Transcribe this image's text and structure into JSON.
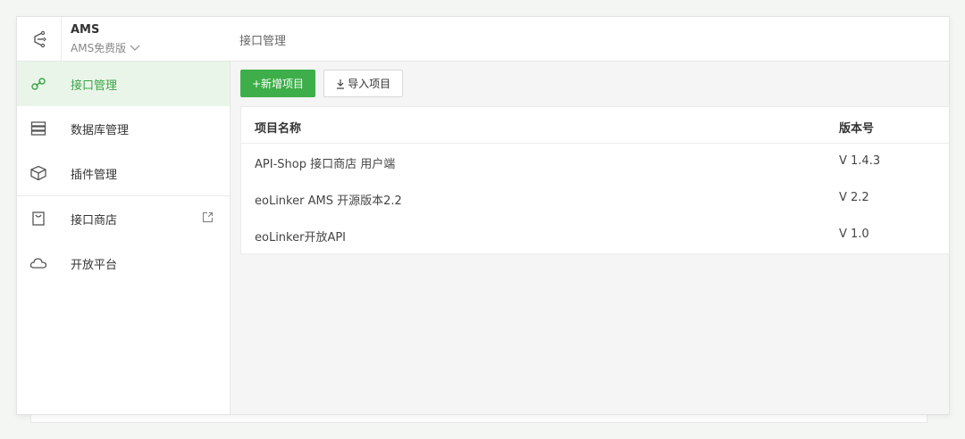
{
  "brand": {
    "name": "AMS",
    "edition": "AMS免费版",
    "logo_icon": "eolinker-logo-icon",
    "accent": "#3dae49"
  },
  "header": {
    "title": "接口管理"
  },
  "sidebar": {
    "items": [
      {
        "label": "接口管理",
        "icon": "link-icon",
        "active": true
      },
      {
        "label": "数据库管理",
        "icon": "database-icon",
        "active": false
      },
      {
        "label": "插件管理",
        "icon": "cube-icon",
        "active": false
      },
      {
        "label": "接口商店",
        "icon": "shopping-bag-icon",
        "active": false,
        "external": true
      },
      {
        "label": "开放平台",
        "icon": "cloud-icon",
        "active": false
      }
    ]
  },
  "toolbar": {
    "add_label": "+新增项目",
    "import_label": "导入项目"
  },
  "table": {
    "columns": [
      "项目名称",
      "版本号"
    ],
    "rows": [
      {
        "name": "API-Shop 接口商店 用户端",
        "version": "V 1.4.3"
      },
      {
        "name": "eoLinker AMS 开源版本2.2",
        "version": "V 2.2"
      },
      {
        "name": "eoLinker开放API",
        "version": "V 1.0"
      }
    ]
  }
}
